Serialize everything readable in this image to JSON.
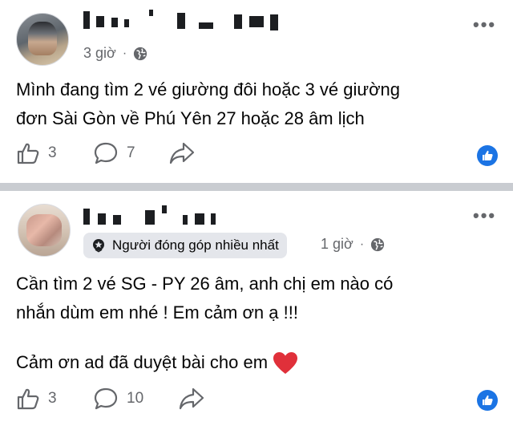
{
  "posts": [
    {
      "name": "Ngu… …ng",
      "time": "3 giờ",
      "text_lines": [
        "Mình đang tìm 2 vé giường đôi hoặc 3 vé giường",
        "đơn Sài Gòn về Phú Yên 27 hoặc 28 âm lịch"
      ],
      "likes": "3",
      "comments": "7"
    },
    {
      "name": "…",
      "badge": "Người đóng góp nhiều nhất",
      "time": "1 giờ",
      "text_lines": [
        "Cần tìm 2 vé SG - PY 26 âm, anh chị em nào có",
        "nhắn dùm em nhé ! Em cảm ơn ạ !!!",
        "Cảm ơn ad đã duyệt bài cho em"
      ],
      "likes": "3",
      "comments": "10"
    }
  ],
  "icons": {
    "more": "more-options-icon",
    "globe": "globe-icon",
    "like": "thumbs-up-icon",
    "comment": "comment-icon",
    "share": "share-icon",
    "badge": "top-contributor-icon",
    "heart": "heart-emoji"
  },
  "colors": {
    "accent": "#1b74e4",
    "heart": "#e0303a",
    "divider": "#c9ccd1",
    "secondary_text": "#65676b"
  }
}
